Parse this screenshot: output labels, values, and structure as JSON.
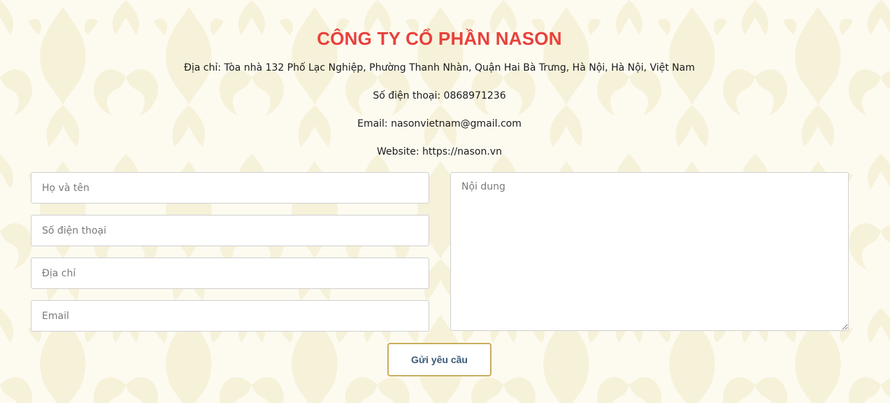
{
  "company": {
    "name": "CÔNG TY CỔ PHẦN NASON",
    "address": "Địa chỉ: Tòa nhà 132 Phố Lạc Nghiệp, Phường Thanh Nhàn, Quận Hai Bà Trưng, Hà Nội, Hà Nội, Việt Nam",
    "phone": "Số điện thoại: 0868971236",
    "email": "Email: nasonvietnam@gmail.com",
    "website": "Website: https://nason.vn"
  },
  "form": {
    "name_placeholder": "Họ và tên",
    "phone_placeholder": "Số điện thoại",
    "address_placeholder": "Địa chỉ",
    "email_placeholder": "Email",
    "content_placeholder": "Nội dung",
    "submit_label": "Gửi yêu cầu"
  },
  "colors": {
    "title": "#e8413c",
    "background": "#fdfbf0",
    "pattern": "#f6f1d8",
    "button_border": "#c9ad5c",
    "button_text": "#3a5a7a"
  }
}
